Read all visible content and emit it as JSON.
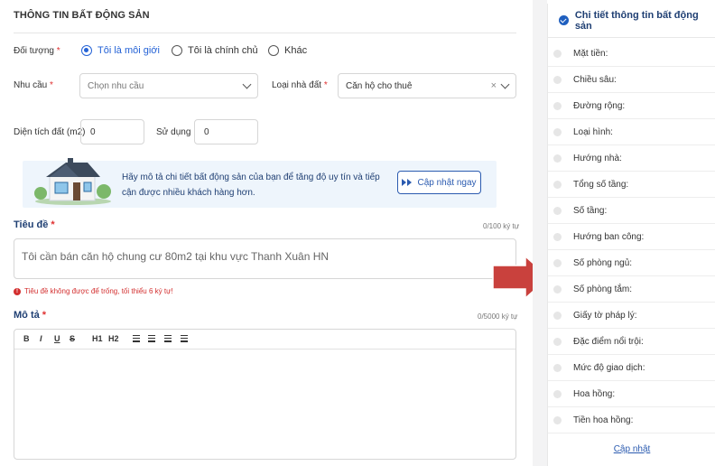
{
  "section_title": "THÔNG TIN BẤT ĐỘNG SẢN",
  "subject": {
    "label": "Đối tượng",
    "required_mark": "*",
    "options": [
      {
        "label": "Tôi là môi giới",
        "selected": true
      },
      {
        "label": "Tôi là chính chủ",
        "selected": false
      },
      {
        "label": "Khác",
        "selected": false
      }
    ]
  },
  "need": {
    "label": "Nhu cầu",
    "required_mark": "*",
    "placeholder": "Chọn nhu cầu"
  },
  "land_type": {
    "label": "Loại nhà đất",
    "required_mark": "*",
    "value": "Căn hộ cho thuê",
    "clear_symbol": "×"
  },
  "area": {
    "label": "Diện tích đất (m2)",
    "value": "0"
  },
  "usage": {
    "label": "Sử dụng",
    "value": "0"
  },
  "banner": {
    "text": "Hãy mô tả chi tiết bất động sản của bạn để tăng độ uy tín và tiếp cận được nhiều khách hàng hơn.",
    "button_label": "Cập nhật ngay"
  },
  "title_field": {
    "label": "Tiêu đề",
    "required_mark": "*",
    "counter": "0/100 ký tự",
    "value": "Tôi cần bán căn hộ chung cư 80m2 tại khu vực Thanh Xuân HN",
    "error": "Tiêu đề không được để trống, tối thiểu 6 ký tự!"
  },
  "description_field": {
    "label": "Mô tả",
    "required_mark": "*",
    "counter": "0/5000 ký tự",
    "toolbar": [
      "B",
      "I",
      "U",
      "S",
      "H1",
      "H2"
    ]
  },
  "sidebar": {
    "title": "Chi tiết thông tin bất động sản",
    "items": [
      "Mặt tiền:",
      "Chiều sâu:",
      "Đường rộng:",
      "Loại hình:",
      "Hướng nhà:",
      "Tổng số tầng:",
      "Số tầng:",
      "Hướng ban công:",
      "Số phòng ngủ:",
      "Số phòng tắm:",
      "Giấy tờ pháp lý:",
      "Đặc điểm nổi trội:",
      "Mức độ giao dịch:",
      "Hoa hồng:",
      "Tiền hoa hồng:"
    ],
    "update_link": "Cập nhật"
  },
  "colors": {
    "accent": "#2563d6",
    "navy": "#1f3f73",
    "error": "#d32f2f",
    "arrow": "#c9413d"
  }
}
